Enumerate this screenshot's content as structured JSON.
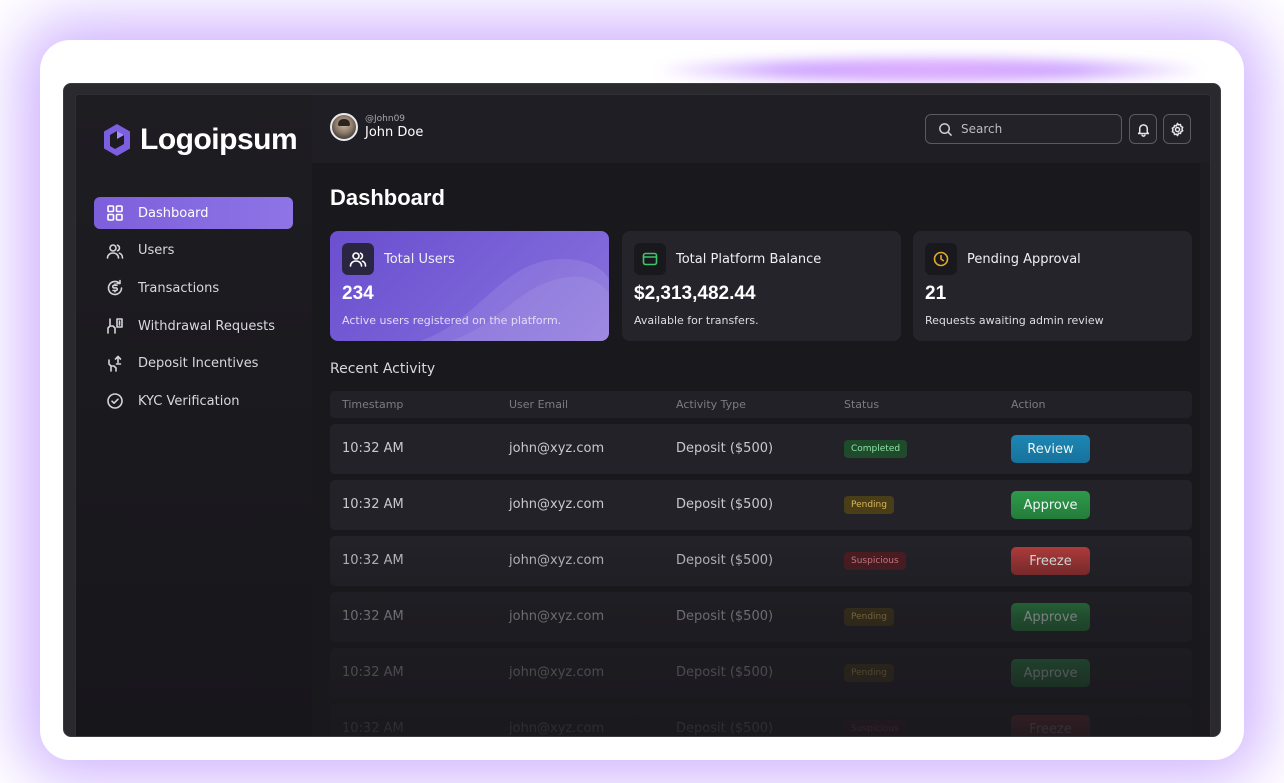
{
  "brand": {
    "name": "Logoipsum",
    "accent": "#7d5fdb"
  },
  "sidebar": {
    "items": [
      {
        "label": "Dashboard",
        "icon": "grid-icon",
        "active": true
      },
      {
        "label": "Users",
        "icon": "users-icon"
      },
      {
        "label": "Transactions",
        "icon": "transactions-icon"
      },
      {
        "label": "Withdrawal Requests",
        "icon": "withdrawal-icon"
      },
      {
        "label": "Deposit Incentives",
        "icon": "deposit-icon"
      },
      {
        "label": "KYC Verification",
        "icon": "check-circle-icon"
      }
    ]
  },
  "header": {
    "user": {
      "handle": "@John09",
      "name": "John Doe"
    },
    "search": {
      "placeholder": "Search"
    },
    "icons": [
      "bell-icon",
      "gear-icon"
    ]
  },
  "main": {
    "title": "Dashboard",
    "cards": [
      {
        "title": "Total Users",
        "value": "234",
        "subtitle": "Active users registered on the platform.",
        "icon": "users-icon"
      },
      {
        "title": "Total Platform Balance",
        "value": "$2,313,482.44",
        "subtitle": "Available for transfers.",
        "icon": "wallet-icon",
        "icon_color": "#3fc46a"
      },
      {
        "title": "Pending Approval",
        "value": "21",
        "subtitle": "Requests awaiting admin review",
        "icon": "clock-icon",
        "icon_color": "#e0a92a"
      }
    ],
    "activity": {
      "title": "Recent Activity",
      "columns": [
        "Timestamp",
        "User Email",
        "Activity Type",
        "Status",
        "Action"
      ],
      "rows": [
        {
          "timestamp": "10:32 AM",
          "email": "john@xyz.com",
          "type": "Deposit ($500)",
          "status": "Completed",
          "action": "Review"
        },
        {
          "timestamp": "10:32 AM",
          "email": "john@xyz.com",
          "type": "Deposit ($500)",
          "status": "Pending",
          "action": "Approve"
        },
        {
          "timestamp": "10:32 AM",
          "email": "john@xyz.com",
          "type": "Deposit ($500)",
          "status": "Suspicious",
          "action": "Freeze"
        },
        {
          "timestamp": "10:32 AM",
          "email": "john@xyz.com",
          "type": "Deposit ($500)",
          "status": "Pending",
          "action": "Approve"
        },
        {
          "timestamp": "10:32 AM",
          "email": "john@xyz.com",
          "type": "Deposit ($500)",
          "status": "Pending",
          "action": "Approve"
        },
        {
          "timestamp": "10:32 AM",
          "email": "john@xyz.com",
          "type": "Deposit ($500)",
          "status": "Suspicious",
          "action": "Freeze"
        }
      ]
    }
  }
}
